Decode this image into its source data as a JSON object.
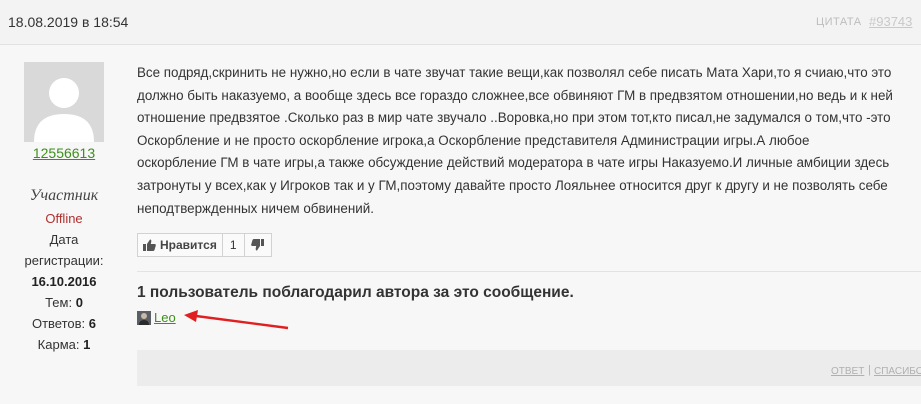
{
  "header": {
    "date": "18.08.2019 в 18:54",
    "quote_label": "ЦИТАТА",
    "post_id": "#93743"
  },
  "user": {
    "name": "12556613",
    "role": "Участник",
    "status": "Offline",
    "reg_label_1": "Дата",
    "reg_label_2": "регистрации:",
    "reg_date": "16.10.2016",
    "topics_label": "Тем:",
    "topics": "0",
    "answers_label": "Ответов:",
    "answers": "6",
    "karma_label": "Карма:",
    "karma": "1"
  },
  "message": {
    "lines": [
      "Все подряд,скринить не нужно,но если в чате звучат такие вещи,как позволял себе писать Мата Хари,то я счиаю,что это",
      "должно быть наказуемо, а вообще здесь все гораздо сложнее,все обвиняют ГМ в предвзятом отношении,но ведь и к ней",
      "отношение предвзятое .Сколько раз в мир чате звучало ..Воровка,но при этом тот,кто писал,не задумался о том,что -это",
      "Оскорбление и не просто оскорбление игрока,а Оскорбление представителя Администрации игры.А любое",
      "оскорбление ГМ в чате игры,а также обсуждение действий модератора в чате игры Наказуемо.И личные амбиции здесь",
      "затронуты у всех,как у Игроков так и у ГМ,поэтому давайте просто Лояльнее относится друг к другу и не позволять себе",
      "неподтвержденных ничем обвинений."
    ]
  },
  "likes": {
    "like_label": "Нравится",
    "like_count": "1"
  },
  "thanks": {
    "title": "1 пользователь поблагодарил автора за это сообщение.",
    "user": "Leo"
  },
  "footer": {
    "reply_label": "ОТВЕТ",
    "separator": "|",
    "thanks_label": "СПАСИБО"
  },
  "colors": {
    "link_green": "#3d8f1c",
    "offline_red": "#b03030",
    "arrow_red": "#e02020"
  }
}
